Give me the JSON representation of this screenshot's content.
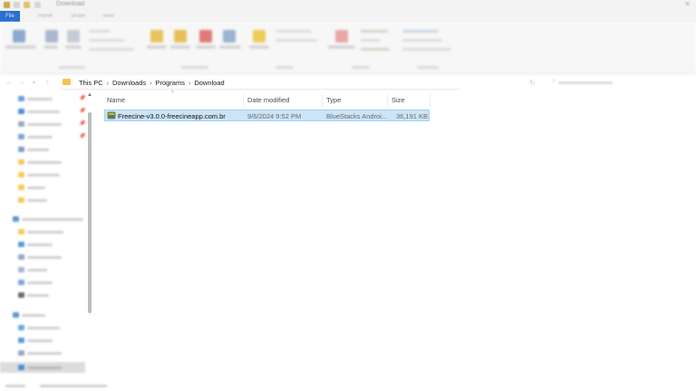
{
  "window": {
    "title": "Download",
    "tabs": [
      {
        "label": "File"
      },
      {
        "label": "Home"
      },
      {
        "label": "Share"
      },
      {
        "label": "View"
      }
    ]
  },
  "address": {
    "crumbs": [
      "This PC",
      "Downloads",
      "Programs",
      "Download"
    ]
  },
  "filelist": {
    "columns": {
      "name": "Name",
      "date": "Date modified",
      "type": "Type",
      "size": "Size"
    },
    "rows": [
      {
        "name": "Freecine-v3.0.0-freecineapp.com.br",
        "date": "9/6/2024 9:52 PM",
        "type": "BlueStacks Androi...",
        "size": "36,191 KB",
        "selected": true
      }
    ]
  },
  "colors": {
    "accent": "#2b6fd1",
    "selection_bg": "#cce4f7",
    "selection_border": "#99d1ff",
    "folder": "#f4c64a"
  },
  "icons": {
    "back": "arrow-left-icon",
    "forward": "arrow-right-icon",
    "recent": "chevron-down-icon",
    "up": "arrow-up-icon",
    "refresh": "refresh-icon",
    "search": "search-icon",
    "pin": "pin-icon",
    "file": "bluestacks-apk-icon"
  }
}
